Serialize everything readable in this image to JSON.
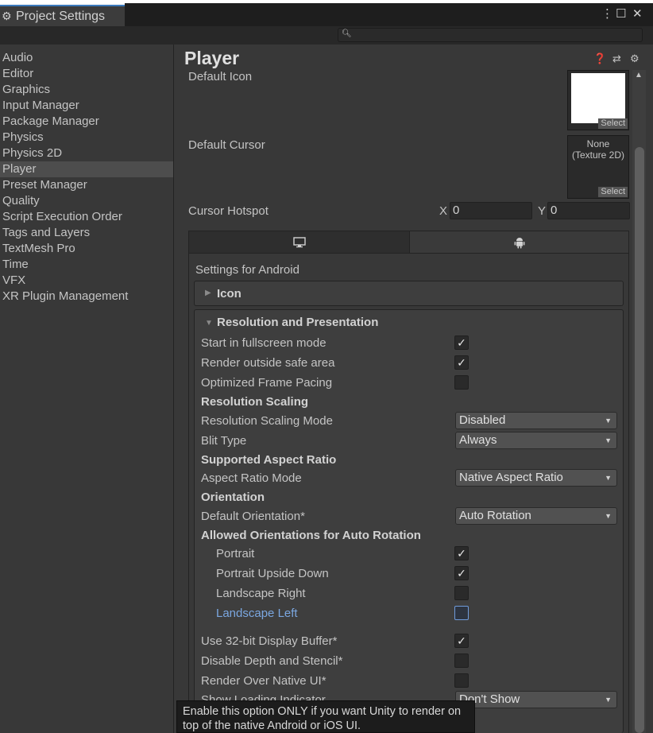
{
  "window": {
    "tab_title": "Project Settings",
    "menu_glyph": "⋮",
    "maximize_glyph": "☐",
    "close_glyph": "✕"
  },
  "search": {
    "placeholder": "",
    "value": ""
  },
  "sidebar": {
    "selected": "Player",
    "items": [
      "Audio",
      "Editor",
      "Graphics",
      "Input Manager",
      "Package Manager",
      "Physics",
      "Physics 2D",
      "Player",
      "Preset Manager",
      "Quality",
      "Script Execution Order",
      "Tags and Layers",
      "TextMesh Pro",
      "Time",
      "VFX",
      "XR Plugin Management"
    ]
  },
  "player": {
    "title": "Player",
    "header_icons": [
      "help-icon",
      "presets-icon",
      "settings-gear-icon"
    ],
    "default_icon_label": "Default Icon",
    "default_cursor_label": "Default Cursor",
    "cursor_texture_text": "None\n(Texture 2D)",
    "select_label": "Select",
    "cursor_hotspot_label": "Cursor Hotspot",
    "hotspot": {
      "x_label": "X",
      "x_value": "0",
      "y_label": "Y",
      "y_value": "0"
    }
  },
  "platform_tabs": {
    "icons": [
      "desktop-icon",
      "android-icon"
    ],
    "active": "android-icon"
  },
  "settings_for": "Settings for Android",
  "foldouts": {
    "icon": "Icon",
    "resolution": "Resolution and Presentation"
  },
  "rows": [
    {
      "label": "Start in fullscreen mode",
      "type": "checkbox",
      "checked": true
    },
    {
      "label": "Render outside safe area",
      "type": "checkbox",
      "checked": true
    },
    {
      "label": "Optimized Frame Pacing",
      "type": "checkbox",
      "checked": false
    },
    {
      "label": "Resolution Scaling",
      "type": "header"
    },
    {
      "label": "Resolution Scaling Mode",
      "type": "dropdown",
      "value": "Disabled"
    },
    {
      "label": "Blit Type",
      "type": "dropdown",
      "value": "Always"
    },
    {
      "label": "Supported Aspect Ratio",
      "type": "header"
    },
    {
      "label": "Aspect Ratio Mode",
      "type": "dropdown",
      "value": "Native Aspect Ratio"
    },
    {
      "label": "Orientation",
      "type": "header"
    },
    {
      "label": "Default Orientation*",
      "type": "dropdown",
      "value": "Auto Rotation"
    },
    {
      "label": "Allowed Orientations for Auto Rotation",
      "type": "header"
    },
    {
      "label": "Portrait",
      "type": "checkbox",
      "checked": true,
      "indent": true
    },
    {
      "label": "Portrait Upside Down",
      "type": "checkbox",
      "checked": true,
      "indent": true
    },
    {
      "label": "Landscape Right",
      "type": "checkbox",
      "checked": false,
      "indent": true
    },
    {
      "label": "Landscape Left",
      "type": "checkbox",
      "checked": false,
      "indent": true,
      "focused": true
    },
    {
      "label": "Use 32-bit Display Buffer*",
      "type": "checkbox",
      "checked": true
    },
    {
      "label": "Disable Depth and Stencil*",
      "type": "checkbox",
      "checked": false
    },
    {
      "label": "Render Over Native UI*",
      "type": "checkbox",
      "checked": false
    },
    {
      "label": "Show Loading Indicator",
      "type": "dropdown",
      "value": "Don't Show"
    }
  ],
  "checkmark_glyph": "✓",
  "tooltip": "Enable this option ONLY if you want Unity to render on top of the native Android or iOS UI.",
  "colors": {
    "selection": "#4d4d4d",
    "accent_blue": "#3a79bb",
    "focus_blue": "#7ba7e0"
  }
}
